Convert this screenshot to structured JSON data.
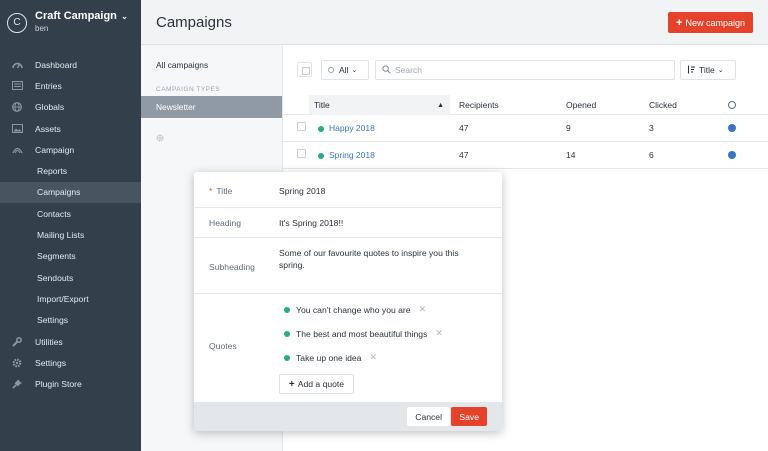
{
  "brand": {
    "logo_letter": "C",
    "title": "Craft Campaign",
    "user": "ben"
  },
  "nav": [
    {
      "label": "Dashboard",
      "icon": "gauge-icon"
    },
    {
      "label": "Entries",
      "icon": "entries-icon"
    },
    {
      "label": "Globals",
      "icon": "globe-icon"
    },
    {
      "label": "Assets",
      "icon": "image-icon"
    },
    {
      "label": "Campaign",
      "icon": "campaign-icon"
    }
  ],
  "campaign_sub": [
    "Reports",
    "Campaigns",
    "Contacts",
    "Mailing Lists",
    "Segments",
    "Sendouts",
    "Import/Export",
    "Settings"
  ],
  "nav_bottom": [
    {
      "label": "Utilities",
      "icon": "wrench-icon"
    },
    {
      "label": "Settings",
      "icon": "gear-icon"
    },
    {
      "label": "Plugin Store",
      "icon": "plug-icon"
    }
  ],
  "header": {
    "title": "Campaigns",
    "new_button": "New campaign"
  },
  "subnav": {
    "all": "All campaigns",
    "heading": "CAMPAIGN TYPES",
    "newsletter": "Newsletter"
  },
  "toolbar": {
    "status": "All",
    "search_placeholder": "Search",
    "sort": "Title"
  },
  "table": {
    "headers": {
      "title": "Title",
      "recipients": "Recipients",
      "opened": "Opened",
      "clicked": "Clicked"
    },
    "rows": [
      {
        "title": "Happy 2018",
        "recipients": "47",
        "opened": "9",
        "clicked": "3"
      },
      {
        "title": "Spring 2018",
        "recipients": "47",
        "opened": "14",
        "clicked": "6"
      }
    ]
  },
  "modal": {
    "title_label": "Title",
    "title_value": "Spring 2018",
    "heading_label": "Heading",
    "heading_value": "It's Spring 2018!!",
    "subheading_label": "Subheading",
    "subheading_line1": "Some of our favourite quotes to inspire you this",
    "subheading_line2": "spring.",
    "quotes_label": "Quotes",
    "quotes": [
      "You can't change who you are",
      "The best and most beautiful things",
      "Take up one idea"
    ],
    "add_quote": "Add a quote",
    "cancel": "Cancel",
    "save": "Save"
  },
  "colors": {
    "sidebar": "#33404c",
    "accent": "#e5422b",
    "link": "#3974c7",
    "status_live": "#27ab83"
  }
}
